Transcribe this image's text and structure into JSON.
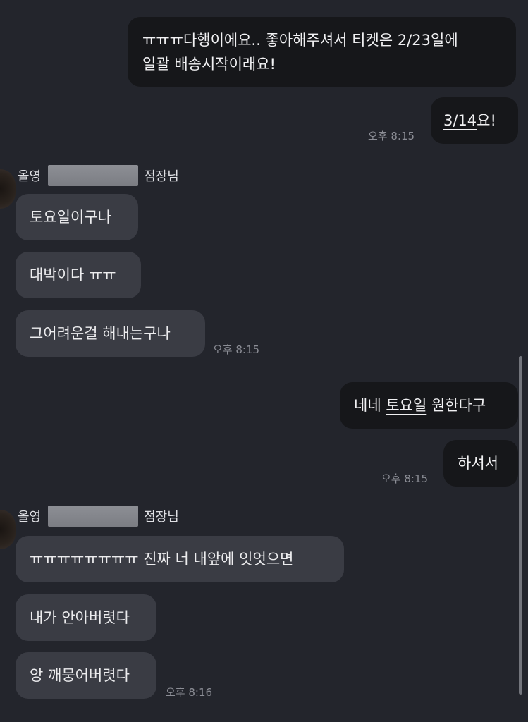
{
  "messages": {
    "m1": {
      "line1_pre": "ㅠㅠㅠ다행이에요.. 좋아해주셔서 티켓은 ",
      "line1_u": "2/23",
      "line1_post": "일에",
      "line2": "일괄 배송시작이래요!"
    },
    "m2": {
      "u": "3/14",
      "post": "요!",
      "time": "오후 8:15"
    },
    "group1": {
      "sender_prefix": "올영",
      "sender_suffix": "점장님",
      "m3": {
        "u": "토요일",
        "post": "이구나"
      },
      "m4": {
        "text": "대박이다 ㅠㅠ"
      },
      "m5": {
        "text": "그어려운걸 해내는구나",
        "time": "오후 8:15"
      }
    },
    "m6": {
      "pre": "네네 ",
      "u": "토요일",
      "post": " 원한다구"
    },
    "m7": {
      "text": "하셔서",
      "time": "오후 8:15"
    },
    "group2": {
      "sender_prefix": "올영",
      "sender_suffix": "점장님",
      "m8": {
        "text": "ㅠㅠㅠㅠㅠㅠㅠㅠ 진짜 너 내앞에 잇엇으면"
      },
      "m9": {
        "text": "내가 안아버렷다"
      },
      "m10": {
        "text": "앙 깨뭉어버렷다",
        "time": "오후 8:16"
      }
    }
  },
  "colors": {
    "background": "#23252c",
    "outgoing_bubble": "#16171a",
    "incoming_bubble": "#3a3c44",
    "timestamp": "#8c8e96"
  }
}
